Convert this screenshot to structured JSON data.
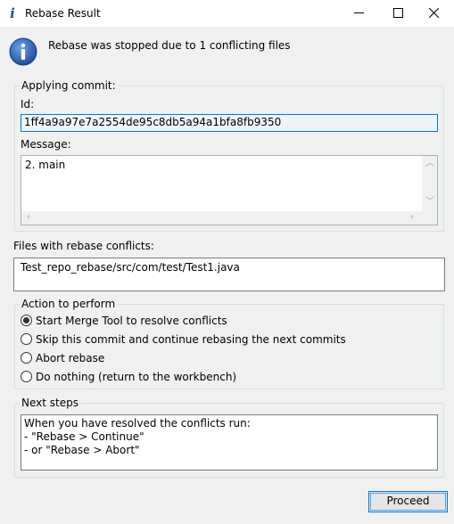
{
  "window": {
    "title": "Rebase Result",
    "title_icon_glyph": "i",
    "controls": {
      "minimize": "minimize-icon",
      "maximize": "maximize-icon",
      "close": "close-icon"
    }
  },
  "header": {
    "icon": "info-icon",
    "message": "Rebase was stopped due to 1 conflicting files"
  },
  "applying_commit": {
    "legend": "Applying commit:",
    "id_label": "Id:",
    "id_value": "1ff4a9a97e7a2554de95c8db5a94a1bfa8fb9350",
    "message_label": "Message:",
    "message_value": "2. main"
  },
  "conflicts": {
    "label": "Files with rebase conflicts:",
    "files_text": "Test_repo_rebase/src/com/test/Test1.java"
  },
  "action": {
    "legend": "Action to perform",
    "options": [
      {
        "label": "Start Merge Tool to resolve conflicts",
        "checked": true
      },
      {
        "label": "Skip this commit and continue rebasing the next commits",
        "checked": false
      },
      {
        "label": "Abort rebase",
        "checked": false
      },
      {
        "label": "Do nothing (return to the workbench)",
        "checked": false
      }
    ]
  },
  "next_steps": {
    "legend": "Next steps",
    "text": "When you have resolved the conflicts run:\n- \"Rebase > Continue\"\n- or \"Rebase > Abort\""
  },
  "footer": {
    "proceed_label": "Proceed"
  },
  "colors": {
    "accent": "#0078d7",
    "info_blue": "#1f4e9c",
    "dialog_bg": "#f0f0f0"
  }
}
